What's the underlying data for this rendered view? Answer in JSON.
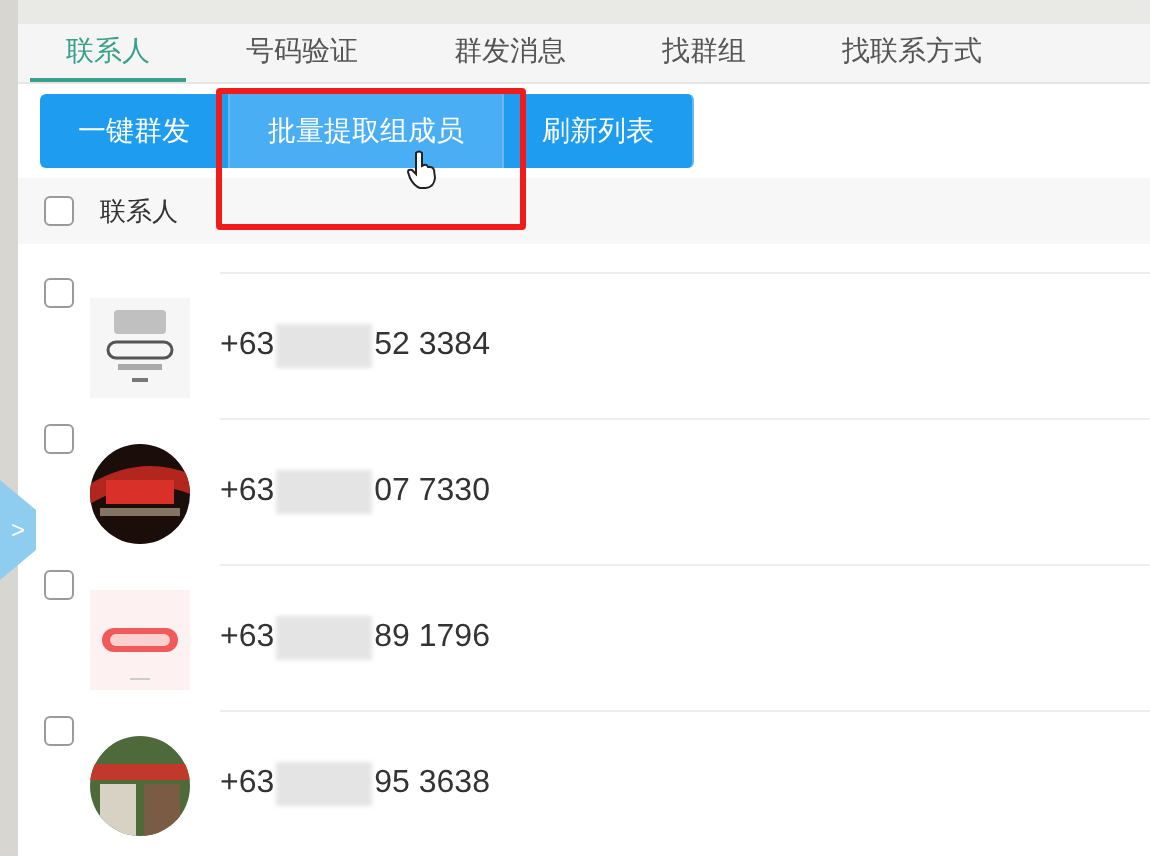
{
  "tabs": [
    {
      "label": "联系人",
      "selected": true
    },
    {
      "label": "号码验证",
      "selected": false
    },
    {
      "label": "群发消息",
      "selected": false
    },
    {
      "label": "找群组",
      "selected": false
    },
    {
      "label": "找联系方式",
      "selected": false
    }
  ],
  "toolbar": [
    {
      "label": "一键群发",
      "hovered": false
    },
    {
      "label": "批量提取组成员",
      "hovered": true
    },
    {
      "label": "刷新列表",
      "hovered": false
    }
  ],
  "header": {
    "label": "联系人",
    "checked": false
  },
  "side_toggle": {
    "label": ">"
  },
  "contacts": [
    {
      "prefix": "+63",
      "suffix": "52 3384",
      "checked": false
    },
    {
      "prefix": "+63",
      "suffix": "07 7330",
      "checked": false
    },
    {
      "prefix": "+63",
      "suffix": "89 1796",
      "checked": false
    },
    {
      "prefix": "+63",
      "suffix": "95 3638",
      "checked": false
    }
  ]
}
